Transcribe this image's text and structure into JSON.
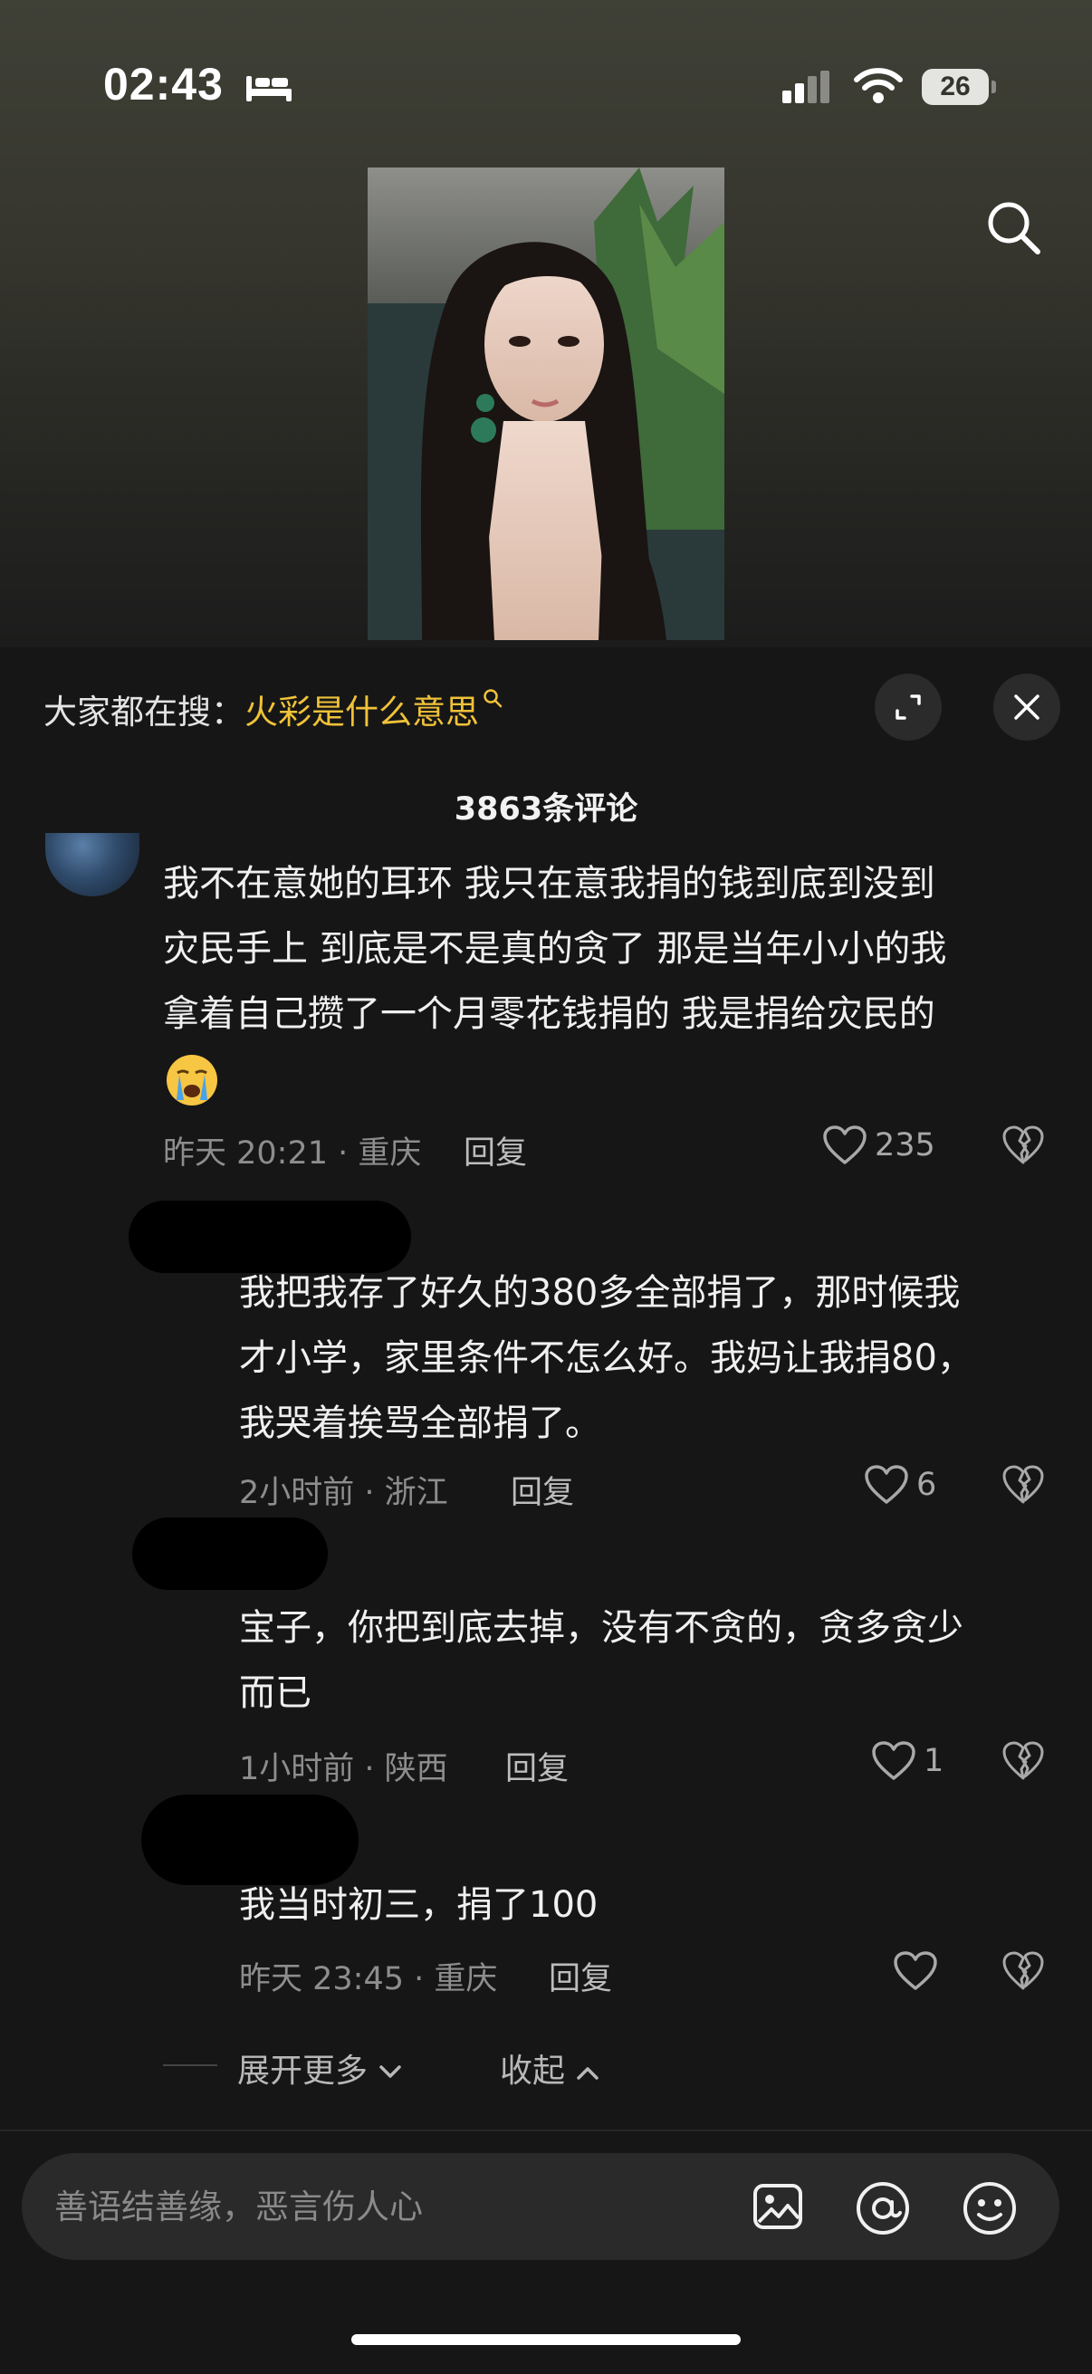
{
  "status_bar": {
    "time": "02:43",
    "battery": "26"
  },
  "video": {
    "search_icon": "search-icon"
  },
  "panel": {
    "trending_label": "大家都在搜：",
    "trending_keyword": "火彩是什么意思",
    "comment_count": "3863条评论"
  },
  "comments": [
    {
      "line1": "我不在意她的耳环 我只在意我捐的钱到底到没到",
      "line2": "灾民手上 到底是不是真的贪了 那是当年小小的我",
      "line3": "拿着自己攒了一个月零花钱捐的 我是捐给灾民的",
      "emoji": "crying-face-emoji",
      "time_location": "昨天 20:21 · 重庆",
      "reply_label": "回复",
      "likes": "235"
    }
  ],
  "replies": [
    {
      "line1": "我把我存了好久的380多全部捐了，那时候我",
      "line2": "才小学，家里条件不怎么好。我妈让我捐80，",
      "line3": "我哭着挨骂全部捐了。",
      "time_location": "2小时前 · 浙江",
      "reply_label": "回复",
      "likes": "6"
    },
    {
      "line1": "宝子，你把到底去掉，没有不贪的，贪多贪少",
      "line2": "而已",
      "time_location": "1小时前 · 陕西",
      "reply_label": "回复",
      "likes": "1"
    },
    {
      "line1": "我当时初三，捐了100",
      "time_location": "昨天 23:45 · 重庆",
      "reply_label": "回复",
      "likes": ""
    }
  ],
  "thread_controls": {
    "expand_more": "展开更多",
    "collapse": "收起"
  },
  "input": {
    "placeholder": "善语结善缘，恶言伤人心"
  }
}
